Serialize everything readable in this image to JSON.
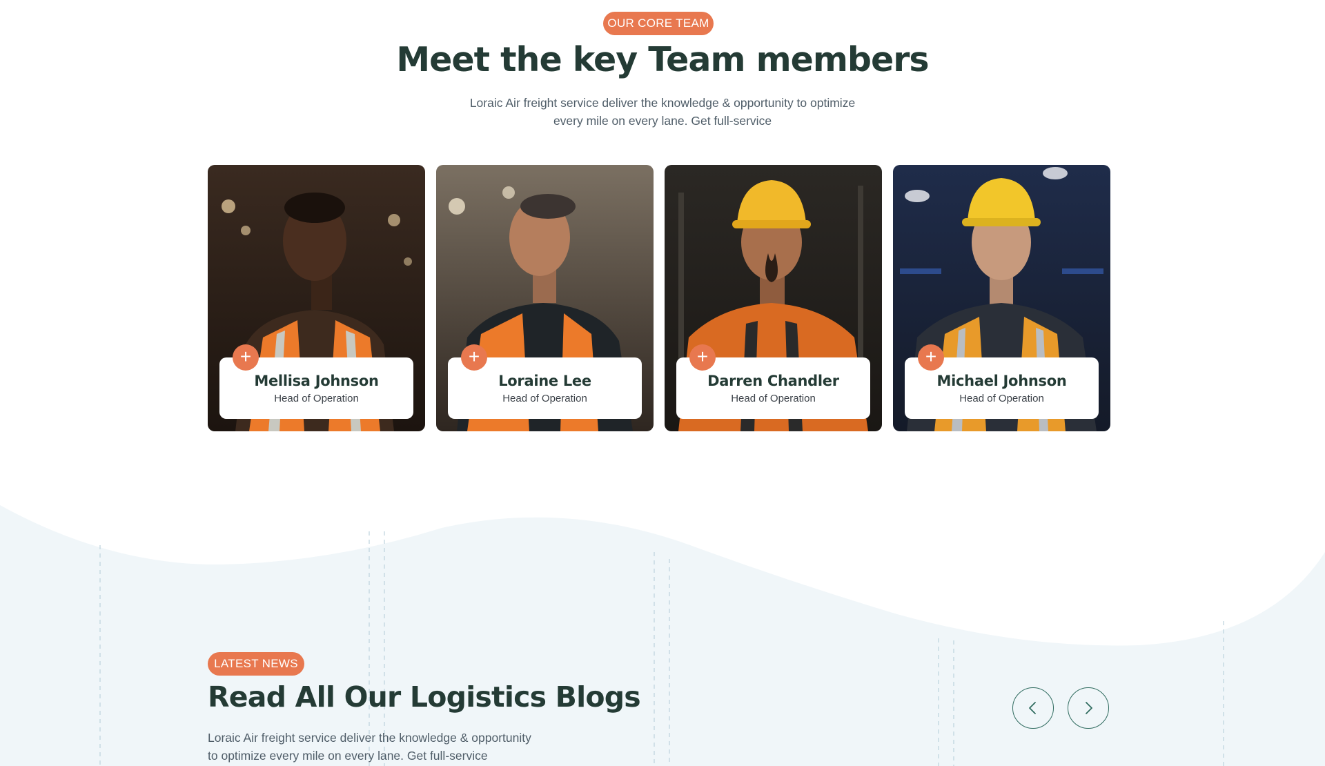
{
  "team": {
    "badge": "OUR CORE TEAM",
    "title": "Meet the key Team members",
    "description_line1": "Loraic Air freight service deliver the knowledge & opportunity to optimize",
    "description_line2": "every mile on every lane. Get full-service",
    "members": [
      {
        "name": "Mellisa Johnson",
        "role": "Head of Operation",
        "helmet": false
      },
      {
        "name": "Loraine Lee",
        "role": "Head of Operation",
        "helmet": false
      },
      {
        "name": "Darren Chandler",
        "role": "Head of Operation",
        "helmet": true
      },
      {
        "name": "Michael Johnson",
        "role": "Head of Operation",
        "helmet": true
      }
    ],
    "expand_icon": "plus-icon"
  },
  "blog": {
    "badge": "LATEST NEWS",
    "title": "Read All Our Logistics Blogs",
    "description_line1": "Loraic Air freight service deliver the knowledge & opportunity",
    "description_line2": "to optimize every mile on every lane. Get full-service",
    "prev_icon": "chevron-left-icon",
    "next_icon": "chevron-right-icon"
  },
  "colors": {
    "accent": "#e8784f",
    "heading": "#243b35",
    "body_text": "#4f5d68",
    "section_bg": "#f0f6f9"
  }
}
